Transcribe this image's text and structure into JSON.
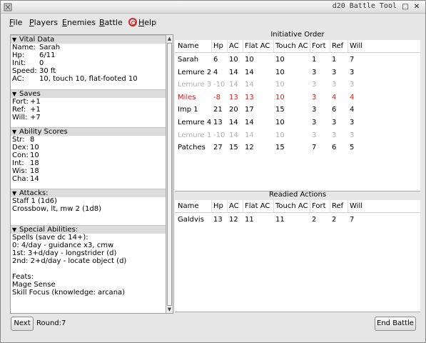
{
  "window": {
    "title": "d20 Battle Tool"
  },
  "menu": {
    "items": [
      {
        "label": "File",
        "u": "F",
        "rest": "ile"
      },
      {
        "label": "Players",
        "u": "P",
        "rest": "layers"
      },
      {
        "label": "Enemies",
        "u": "E",
        "rest": "nemies"
      },
      {
        "label": "Battle",
        "u": "B",
        "rest": "attle"
      },
      {
        "label": "Help",
        "u": "H",
        "rest": "elp"
      }
    ]
  },
  "left": {
    "vital": {
      "header": "Vital Data",
      "rows": [
        {
          "k": "Name:",
          "v": "Sarah"
        },
        {
          "k": "Hp:",
          "v": "6/11"
        },
        {
          "k": "Init:",
          "v": "0"
        },
        {
          "k": "Speed:",
          "v": "30 ft"
        },
        {
          "k": "AC:",
          "v": "10, touch 10, flat-footed 10"
        }
      ]
    },
    "saves": {
      "header": "Saves",
      "rows": [
        {
          "k": "Fort:",
          "v": "+1"
        },
        {
          "k": "Ref:",
          "v": "+1"
        },
        {
          "k": "Will:",
          "v": "+7"
        }
      ]
    },
    "abilities": {
      "header": "Ability Scores",
      "rows": [
        {
          "k": "Str:",
          "v": "8"
        },
        {
          "k": "Dex:",
          "v": "10"
        },
        {
          "k": "Con:",
          "v": "10"
        },
        {
          "k": "Int:",
          "v": "18"
        },
        {
          "k": "Wis:",
          "v": "18"
        },
        {
          "k": "Cha:",
          "v": "14"
        }
      ]
    },
    "attacks": {
      "header": "Attacks:",
      "lines": [
        "Staff 1 (1d6)",
        "Crossbow, lt, mw 2 (1d8)"
      ]
    },
    "special": {
      "header": "Special Abilities:",
      "lines": [
        "Spells (save dc 14+):",
        "0: 4/day - guidance x3, cmw",
        "1st: 3+d/day - longstrider (d)",
        "2nd: 2+d/day - locate object (d)",
        "",
        "Feats:",
        "Mage Sense",
        "Skill Focus (knowledge: arcana)"
      ]
    }
  },
  "initiative": {
    "title": "Initiative Order",
    "columns": [
      "Name",
      "Hp",
      "AC",
      "Flat AC",
      "Touch AC",
      "Fort",
      "Ref",
      "Will"
    ],
    "rows": [
      {
        "cells": [
          "Sarah",
          "6",
          "10",
          "10",
          "10",
          "1",
          "1",
          "7"
        ],
        "state": "normal"
      },
      {
        "cells": [
          "Lemure 2",
          "4",
          "14",
          "14",
          "10",
          "3",
          "3",
          "3"
        ],
        "state": "normal"
      },
      {
        "cells": [
          "Lemure 3",
          "-10",
          "14",
          "14",
          "10",
          "3",
          "3",
          "3"
        ],
        "state": "dead"
      },
      {
        "cells": [
          "Miles",
          "-8",
          "13",
          "13",
          "10",
          "3",
          "4",
          "4"
        ],
        "state": "dying"
      },
      {
        "cells": [
          "Imp 1",
          "21",
          "20",
          "17",
          "15",
          "3",
          "6",
          "4"
        ],
        "state": "normal"
      },
      {
        "cells": [
          "Lemure 4",
          "13",
          "14",
          "14",
          "10",
          "3",
          "3",
          "3"
        ],
        "state": "normal"
      },
      {
        "cells": [
          "Lemure 1",
          "-10",
          "14",
          "14",
          "10",
          "3",
          "3",
          "3"
        ],
        "state": "dead"
      },
      {
        "cells": [
          "Patches",
          "27",
          "15",
          "12",
          "15",
          "7",
          "6",
          "5"
        ],
        "state": "normal"
      }
    ]
  },
  "readied": {
    "title": "Readied Actions",
    "columns": [
      "Name",
      "Hp",
      "AC",
      "Flat AC",
      "Touch AC",
      "Fort",
      "Ref",
      "Will"
    ],
    "rows": [
      {
        "cells": [
          "Galdvis",
          "13",
          "12",
          "11",
          "11",
          "2",
          "2",
          "7"
        ],
        "state": "normal"
      }
    ]
  },
  "footer": {
    "next_label": "Next",
    "round_label": "Round:7",
    "end_label": "End Battle"
  },
  "colors": {
    "dying": "#cc2222",
    "dead": "#b0b0b0"
  }
}
